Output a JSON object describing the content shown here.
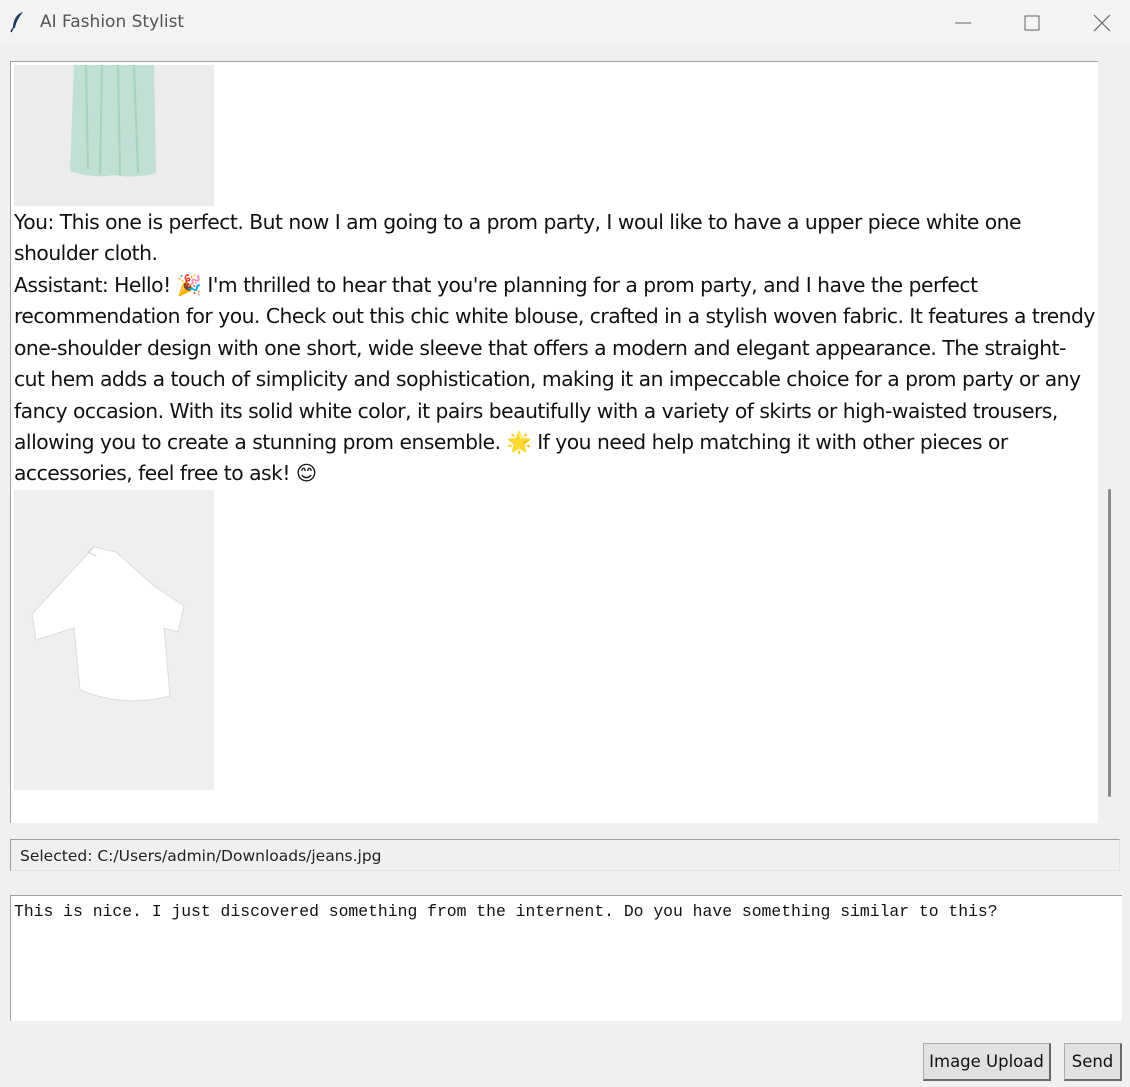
{
  "window": {
    "title": "AI Fashion Stylist",
    "icon": "feather-icon",
    "controls": [
      "minimize-icon",
      "maximize-icon",
      "close-icon"
    ]
  },
  "chat": {
    "images": [
      {
        "name": "mint-green-skirt-image"
      },
      {
        "name": "white-one-shoulder-blouse-image"
      }
    ],
    "user_message": "You: This one is perfect. But now I am going to a prom party, I woul like to have a upper piece white one shoulder cloth.",
    "assistant_message": "Assistant: Hello! 🎉 I'm thrilled to hear that you're planning for a prom party, and I have the perfect recommendation for you. Check out this chic white blouse, crafted in a stylish woven fabric. It features a trendy one-shoulder design with one short, wide sleeve that offers a modern and elegant appearance. The straight-cut hem adds a touch of simplicity and sophistication, making it an impeccable choice for a prom party or any fancy occasion. With its solid white color, it pairs beautifully with a variety of skirts or high-waisted trousers, allowing you to create a stunning prom ensemble. 🌟 If you need help matching it with other pieces or accessories, feel free to ask! 😊"
  },
  "status": {
    "selected_file": "Selected: C:/Users/admin/Downloads/jeans.jpg"
  },
  "input": {
    "value": "This is nice. I just discovered something from the internent. Do you have something similar to this?"
  },
  "buttons": {
    "upload_label": "Image Upload",
    "send_label": "Send"
  },
  "colors": {
    "window_bg": "#f0f0f0",
    "panel_bg": "#ffffff",
    "button_bg": "#e1e1e1"
  }
}
